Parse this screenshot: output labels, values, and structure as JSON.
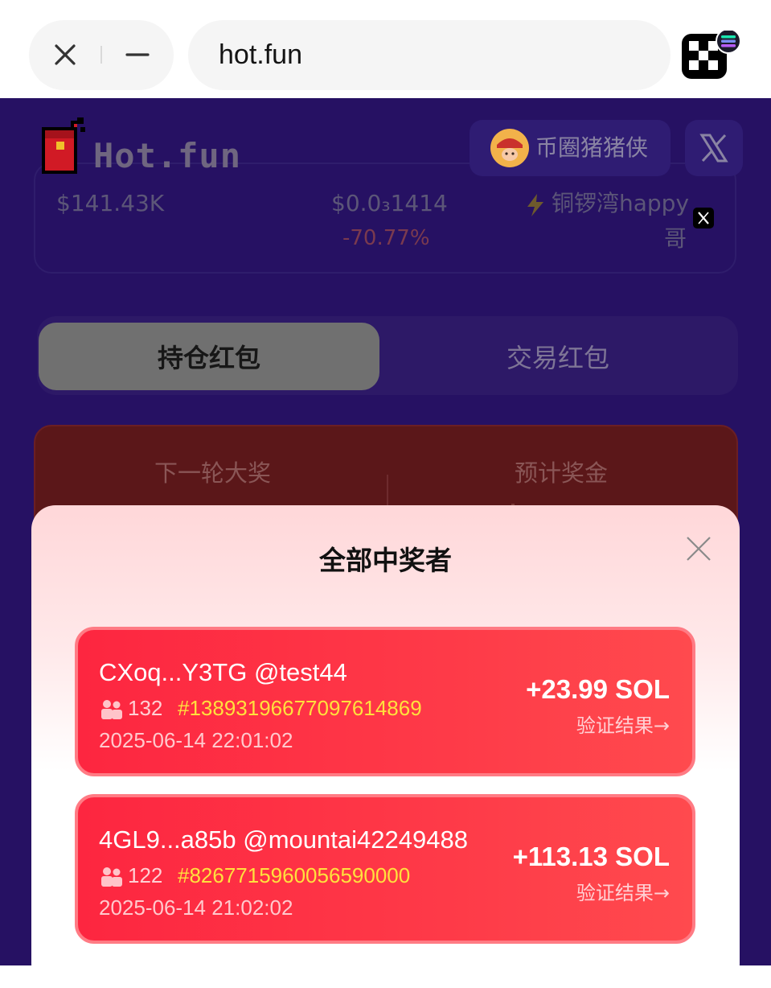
{
  "browser": {
    "url": "hot.fun",
    "close_icon": "close-icon",
    "minimize_icon": "minimize-icon",
    "wallet_icon": "okx-wallet-icon"
  },
  "header": {
    "logo_text": "Hot.fun",
    "user_name": "币圈猪猪侠",
    "social": "x-icon"
  },
  "stats": {
    "market_cap": "$141.43K",
    "price": "$0.0₃1414",
    "price_change": "-70.77%",
    "creator_line1": "铜锣湾happy",
    "creator_line2": "哥"
  },
  "tabs": {
    "holding": "持仓红包",
    "trading": "交易红包"
  },
  "prize": {
    "next_round_label": "下一轮大奖",
    "estimated_label": "预计奖金"
  },
  "modal": {
    "title": "全部中奖者",
    "winners": [
      {
        "address": "CXoq...Y3TG @test44",
        "count": "132",
        "hash": "#13893196677097614869",
        "date": "2025-06-14 22:01:02",
        "amount": "+23.99 SOL",
        "verify": "验证结果→"
      },
      {
        "address": "4GL9...a85b @mountai42249488",
        "count": "122",
        "hash": "#8267715960056590000",
        "date": "2025-06-14 21:02:02",
        "amount": "+113.13 SOL",
        "verify": "验证结果→"
      }
    ]
  },
  "colors": {
    "page_bg": "#261163",
    "card_red": "#fd2640",
    "hash_yellow": "#ffe13d",
    "prize_panel": "#5b1719"
  }
}
